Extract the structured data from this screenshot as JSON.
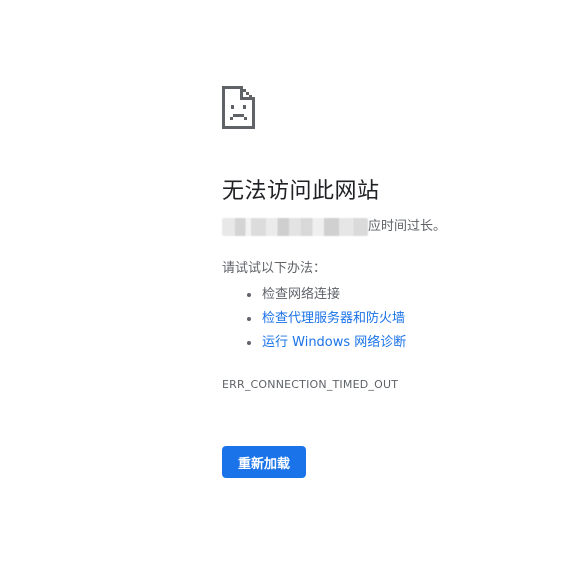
{
  "error_page": {
    "title": "无法访问此网站",
    "description_suffix": "应时间过长。",
    "suggestions_heading": "请试试以下办法：",
    "suggestions": [
      {
        "label": "检查网络连接",
        "link": false
      },
      {
        "label": "检查代理服务器和防火墙",
        "link": true
      },
      {
        "label": "运行 Windows 网络诊断",
        "link": true
      }
    ],
    "error_code": "ERR_CONNECTION_TIMED_OUT",
    "reload_label": "重新加载"
  },
  "icons": {
    "sad_page": "sad-page-icon"
  },
  "colors": {
    "link": "#1a73e8",
    "button": "#1a73e8",
    "text_primary": "#202124",
    "text_secondary": "#5f6368"
  }
}
